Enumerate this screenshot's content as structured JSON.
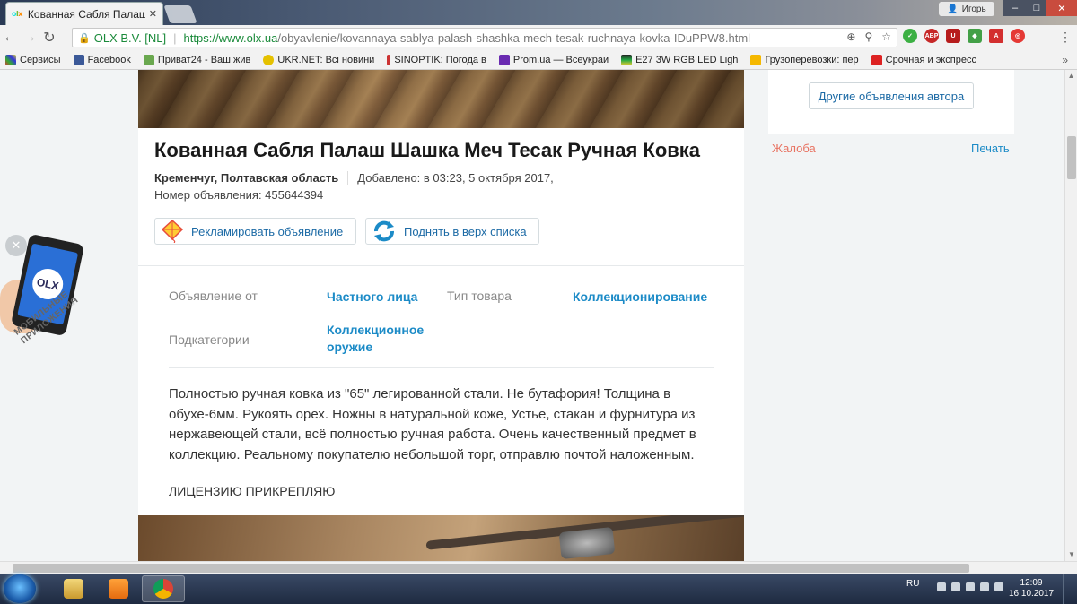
{
  "browser": {
    "tab_title": "Кованная Сабля Палаш",
    "tab_favicon": "olx-favicon",
    "profile_name": "Игорь",
    "url_secure_label": "OLX B.V. [NL]",
    "url_host": "https://www.olx.ua",
    "url_path": "/obyavlenie/kovannaya-sablya-palash-shashka-mech-tesak-ruchnaya-kovka-IDuPPW8.html"
  },
  "bookmarks": [
    {
      "label": "Сервисы",
      "color": "#d33"
    },
    {
      "label": "Facebook",
      "color": "#3b5998"
    },
    {
      "label": "Приват24 - Ваш жив",
      "color": "#6aa84f"
    },
    {
      "label": "UKR.NET: Всі новини",
      "color": "#e5c100"
    },
    {
      "label": "SINOPTIK: Погода в",
      "color": "#c33"
    },
    {
      "label": "Prom.ua — Всеукраи",
      "color": "#6a2bb1"
    },
    {
      "label": "E27 3W RGB LED Ligh",
      "color": "#222"
    },
    {
      "label": "Грузоперевозки: пер",
      "color": "#f5b800"
    },
    {
      "label": "Срочная и экспресс",
      "color": "#d22"
    }
  ],
  "listing": {
    "title": "Кованная Сабля Палаш Шашка Меч Тесак Ручная Ковка",
    "location": "Кременчуг, Полтавская область",
    "added": "Добавлено: в 03:23, 5 октября 2017,",
    "ad_number": "Номер объявления: 455644394",
    "promote_label": "Рекламировать объявление",
    "bump_label": "Поднять в верх списка",
    "params": [
      {
        "label": "Объявление от",
        "value": "Частного лица"
      },
      {
        "label": "Тип товара",
        "value": "Коллекционирование"
      },
      {
        "label": "Подкатегории",
        "value": "Коллекционное оружие"
      }
    ],
    "description": "Полностью ручная ковка из \"65\" легированной стали. Не бутафория! Толщина в обухе-6мм. Рукоять орех. Ножны в натуральной коже, Устье, стакан и фурнитура из нержавеющей стали, всё полностью ручная работа. Очень качественный предмет в коллекцию. Реальному покупателю небольшой торг, отправлю почтой наложенным.",
    "license": "ЛИЦЕНЗИЮ ПРИКРЕПЛЯЮ"
  },
  "sidebar": {
    "author_ads_label": "Другие объявления автора",
    "complaint_label": "Жалоба",
    "print_label": "Печать"
  },
  "promo_app": {
    "logo_text": "OLX",
    "caption": "МОБИЛЬНЫЕ ПРИЛОЖЕНИЯ"
  },
  "taskbar": {
    "lang": "RU",
    "time": "12:09",
    "date": "16.10.2017"
  },
  "colors": {
    "link_blue": "#1c8bc7",
    "complaint_red": "#e87261",
    "secure_green": "#1a8a3a"
  }
}
